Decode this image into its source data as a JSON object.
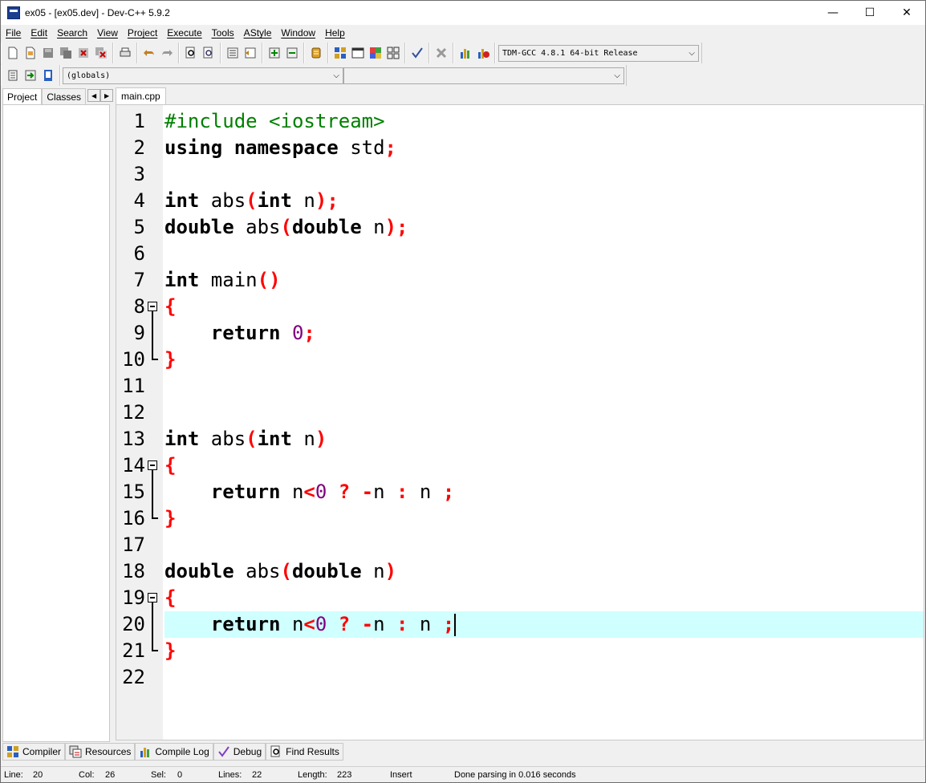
{
  "window": {
    "title": "ex05 - [ex05.dev] - Dev-C++ 5.9.2",
    "minimize": "—",
    "maximize": "☐",
    "close": "✕"
  },
  "menu": [
    "File",
    "Edit",
    "Search",
    "View",
    "Project",
    "Execute",
    "Tools",
    "AStyle",
    "Window",
    "Help"
  ],
  "toolbar": {
    "compiler_select": "TDM-GCC 4.8.1 64-bit Release",
    "scope_select": "(globals)",
    "member_select": ""
  },
  "left_tabs": [
    "Project",
    "Classes"
  ],
  "editor": {
    "file_tab": "main.cpp",
    "lines": [
      {
        "n": "1",
        "code": "#include <iostream>"
      },
      {
        "n": "2",
        "code": "using namespace std;"
      },
      {
        "n": "3",
        "code": ""
      },
      {
        "n": "4",
        "code": "int abs(int n);"
      },
      {
        "n": "5",
        "code": "double abs(double n);"
      },
      {
        "n": "6",
        "code": ""
      },
      {
        "n": "7",
        "code": "int main()"
      },
      {
        "n": "8",
        "code": "{"
      },
      {
        "n": "9",
        "code": "    return 0;"
      },
      {
        "n": "10",
        "code": "}"
      },
      {
        "n": "11",
        "code": ""
      },
      {
        "n": "12",
        "code": ""
      },
      {
        "n": "13",
        "code": "int abs(int n)"
      },
      {
        "n": "14",
        "code": "{"
      },
      {
        "n": "15",
        "code": "    return n<0 ? -n : n ;"
      },
      {
        "n": "16",
        "code": "}"
      },
      {
        "n": "17",
        "code": ""
      },
      {
        "n": "18",
        "code": "double abs(double n)"
      },
      {
        "n": "19",
        "code": "{"
      },
      {
        "n": "20",
        "code": "    return n<0 ? -n : n ;"
      },
      {
        "n": "21",
        "code": "}"
      },
      {
        "n": "22",
        "code": ""
      }
    ],
    "current_line": 20
  },
  "bottom_tabs": [
    "Compiler",
    "Resources",
    "Compile Log",
    "Debug",
    "Find Results"
  ],
  "status": {
    "line_label": "Line:",
    "line_value": "20",
    "col_label": "Col:",
    "col_value": "26",
    "sel_label": "Sel:",
    "sel_value": "0",
    "lines_label": "Lines:",
    "lines_value": "22",
    "length_label": "Length:",
    "length_value": "223",
    "mode": "Insert",
    "message": "Done parsing in 0.016 seconds"
  },
  "colors": {
    "keyword": "#000000",
    "preprocessor": "#008000",
    "symbol": "#ff0000",
    "number": "#800080",
    "current_line": "#cfffff"
  }
}
